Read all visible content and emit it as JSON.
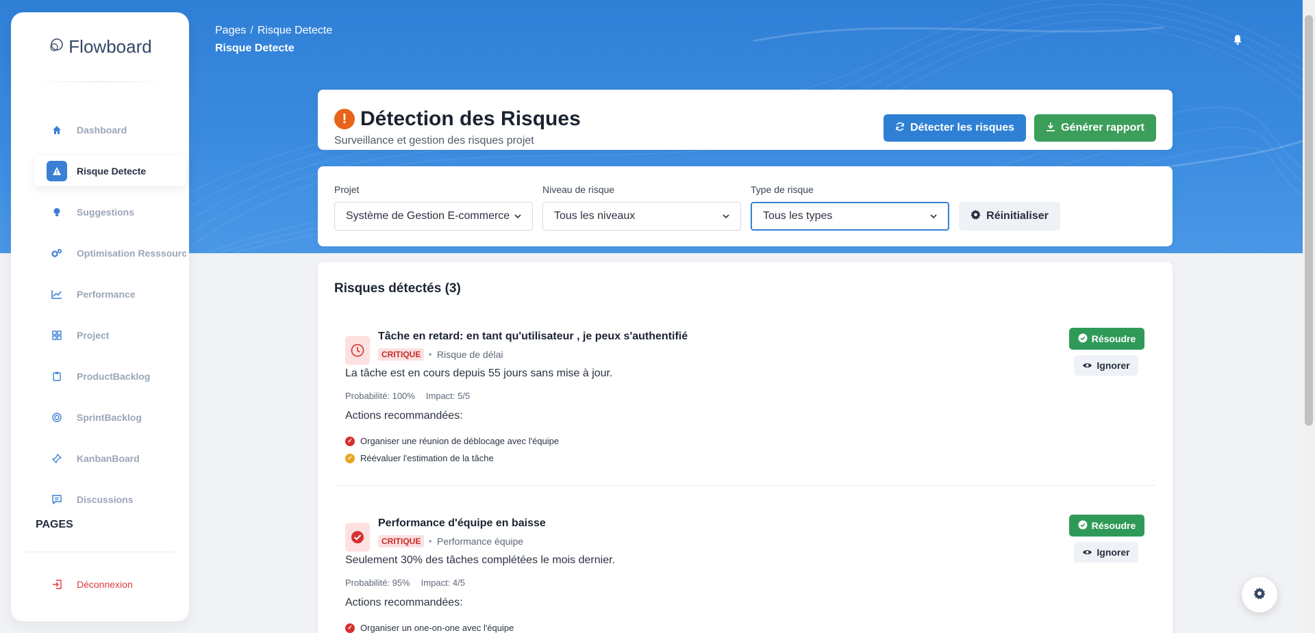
{
  "brand": {
    "name": "Flowboard"
  },
  "sidebar": {
    "items": [
      {
        "label": "Dashboard",
        "icon": "home-icon"
      },
      {
        "label": "Risque Detecte",
        "icon": "warning-icon",
        "active": true
      },
      {
        "label": "Suggestions",
        "icon": "lightbulb-icon"
      },
      {
        "label": "Optimisation Resssource",
        "icon": "cogs-icon"
      },
      {
        "label": "Performance",
        "icon": "chart-line-icon"
      },
      {
        "label": "Project",
        "icon": "grid-icon"
      },
      {
        "label": "ProductBacklog",
        "icon": "clipboard-icon"
      },
      {
        "label": "SprintBacklog",
        "icon": "target-icon"
      },
      {
        "label": "KanbanBoard",
        "icon": "pin-icon"
      },
      {
        "label": "Discussions",
        "icon": "chat-icon"
      }
    ],
    "pages_title": "PAGES",
    "logout_label": "Déconnexion"
  },
  "breadcrumb": {
    "root": "Pages",
    "separator": "/",
    "current": "Risque Detecte"
  },
  "page_title": "Risque Detecte",
  "header": {
    "title": "Détection des Risques",
    "subtitle": "Surveillance et gestion des risques projet",
    "detect_label": "Détecter les risques",
    "report_label": "Générer rapport"
  },
  "filters": {
    "project_label": "Projet",
    "project_value": "Système de Gestion E-commerce",
    "level_label": "Niveau de risque",
    "level_value": "Tous les niveaux",
    "type_label": "Type de risque",
    "type_value": "Tous les types",
    "reset_label": "Réinitialiser"
  },
  "risks": {
    "title": "Risques détectés (3)",
    "items": [
      {
        "title": "Tâche en retard: en tant qu'utilisateur , je peux s'authentifié",
        "severity": "CRITIQUE",
        "type": "Risque de délai",
        "description": "La tâche est en cours depuis 55 jours sans mise à jour.",
        "probability": "Probabilité: 100%",
        "impact": "Impact: 5/5",
        "actions_title": "Actions recommandées:",
        "actions": [
          "Organiser une réunion de déblocage avec l'équipe",
          "Réévaluer l'estimation de la tâche"
        ],
        "resolve_label": "Résoudre",
        "ignore_label": "Ignorer"
      },
      {
        "title": "Performance d'équipe en baisse",
        "severity": "CRITIQUE",
        "type": "Performance équipe",
        "description": "Seulement 30% des tâches complétées le mois dernier.",
        "probability": "Probabilité: 95%",
        "impact": "Impact: 4/5",
        "actions_title": "Actions recommandées:",
        "actions": [
          "Organiser un one-on-one avec l'équipe"
        ],
        "resolve_label": "Résoudre",
        "ignore_label": "Ignorer"
      }
    ]
  },
  "colors": {
    "primary": "#2f80d5",
    "success": "#3b9e5a",
    "danger": "#d63030",
    "warning": "#e8641b"
  }
}
